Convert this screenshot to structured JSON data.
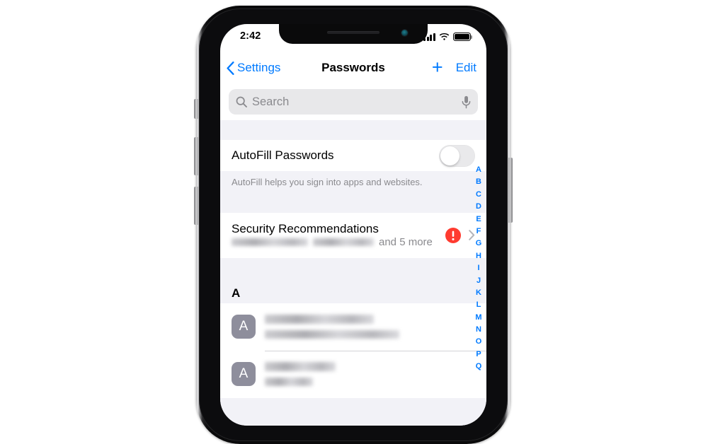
{
  "status_bar": {
    "time": "2:42",
    "signal_icon": "cellular-signal-icon",
    "signal_bars_filled": 3,
    "signal_bars_total": 4,
    "wifi_icon": "wifi-icon",
    "battery_icon": "battery-icon",
    "battery_level_full": true
  },
  "nav": {
    "back_label": "Settings",
    "back_icon": "chevron-left-icon",
    "title": "Passwords",
    "add_label": "+",
    "add_icon": "plus-icon",
    "edit_label": "Edit"
  },
  "search": {
    "placeholder": "Search",
    "value": "",
    "search_icon": "search-icon",
    "mic_icon": "microphone-icon"
  },
  "autofill": {
    "label": "AutoFill Passwords",
    "toggle_state": "off",
    "footnote": "AutoFill helps you sign into apps and websites."
  },
  "security": {
    "title": "Security Recommendations",
    "subtitle_suffix": "and 5 more",
    "redacted_items": 2,
    "warning_icon": "warning-exclamation-icon",
    "disclosure_icon": "chevron-right-icon"
  },
  "sections": [
    {
      "header": "A",
      "rows": [
        {
          "avatar_letter": "A",
          "title_redacted": true,
          "subtitle_redacted": true
        },
        {
          "avatar_letter": "A",
          "title_redacted": true,
          "subtitle_redacted": true
        }
      ]
    }
  ],
  "index_bar": {
    "letters": [
      "A",
      "B",
      "C",
      "D",
      "E",
      "F",
      "G",
      "H",
      "I",
      "J",
      "K",
      "L",
      "M",
      "N",
      "O",
      "P",
      "Q"
    ]
  },
  "colors": {
    "accent_blue": "#007aff",
    "warning_red": "#ff3b30",
    "group_background": "#f2f2f7",
    "row_background": "#ffffff",
    "secondary_text": "#8a8a8e",
    "search_field": "#e8e8ea",
    "avatar": "#8e8e9c"
  },
  "device": {
    "side_buttons": [
      "silent-switch",
      "volume-up-button",
      "volume-down-button",
      "power-button"
    ],
    "notch_elements": [
      "earpiece-speaker",
      "front-camera"
    ]
  }
}
